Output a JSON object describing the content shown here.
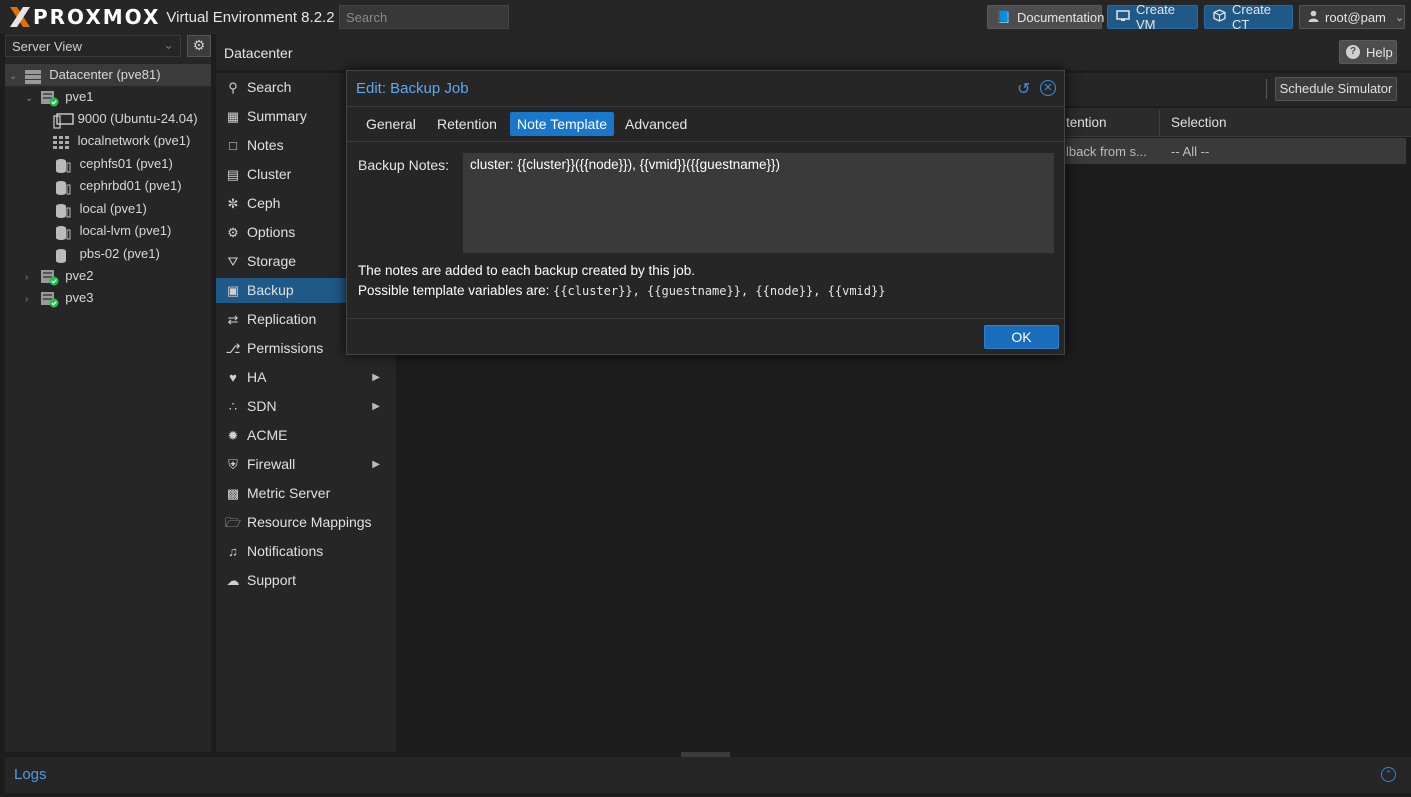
{
  "topbar": {
    "brand": "PROXMOX",
    "product": "Virtual Environment 8.2.2",
    "search_placeholder": "Search",
    "documentation": "Documentation",
    "create_vm": "Create VM",
    "create_ct": "Create CT",
    "user": "root@pam"
  },
  "tree": {
    "view": "Server View",
    "items": [
      {
        "label": "Datacenter (pve81)"
      },
      {
        "label": "pve1"
      },
      {
        "label": "9000 (Ubuntu-24.04)"
      },
      {
        "label": "localnetwork (pve1)"
      },
      {
        "label": "cephfs01 (pve1)"
      },
      {
        "label": "cephrbd01 (pve1)"
      },
      {
        "label": "local (pve1)"
      },
      {
        "label": "local-lvm (pve1)"
      },
      {
        "label": "pbs-02 (pve1)"
      },
      {
        "label": "pve2"
      },
      {
        "label": "pve3"
      }
    ]
  },
  "header": {
    "title": "Datacenter",
    "help": "Help"
  },
  "nav": {
    "items": [
      {
        "label": "Search"
      },
      {
        "label": "Summary"
      },
      {
        "label": "Notes"
      },
      {
        "label": "Cluster"
      },
      {
        "label": "Ceph"
      },
      {
        "label": "Options"
      },
      {
        "label": "Storage"
      },
      {
        "label": "Backup"
      },
      {
        "label": "Replication"
      },
      {
        "label": "Permissions"
      },
      {
        "label": "HA"
      },
      {
        "label": "SDN"
      },
      {
        "label": "ACME"
      },
      {
        "label": "Firewall"
      },
      {
        "label": "Metric Server"
      },
      {
        "label": "Resource Mappings"
      },
      {
        "label": "Notifications"
      },
      {
        "label": "Support"
      }
    ]
  },
  "content": {
    "schedule_simulator": "Schedule Simulator",
    "columns": [
      "tention",
      "Selection"
    ],
    "row": [
      "lback from s...",
      "-- All --"
    ]
  },
  "modal": {
    "title": "Edit: Backup Job",
    "tabs": [
      "General",
      "Retention",
      "Note Template",
      "Advanced"
    ],
    "active_tab": "Note Template",
    "notes_label": "Backup Notes:",
    "notes_value": "cluster: {{cluster}}({{node}}), {{vmid}}({{guestname}})",
    "info_line1": "The notes are added to each backup created by this job.",
    "info_line2_prefix": "Possible template variables are: ",
    "info_line2_vars": "{{cluster}}, {{guestname}}, {{node}}, {{vmid}}",
    "ok": "OK"
  },
  "logs": {
    "title": "Logs"
  }
}
